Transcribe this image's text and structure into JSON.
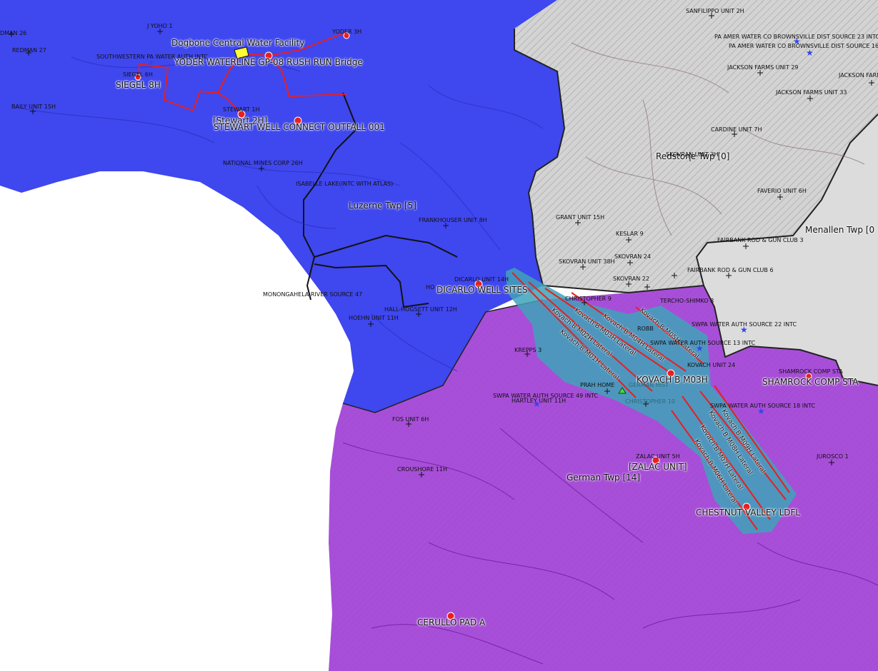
{
  "map": {
    "colors": {
      "luzerne": "#3f47ee",
      "german": "#a84fd9",
      "redstone": "#d3d3d3",
      "menallen": "#dcdcdc",
      "corridor": "#3fa2b8",
      "pipeline_red": "#e81f1f",
      "road": "#121212",
      "background": "#ffffff"
    },
    "townships": {
      "luzerne": "Luzerne Twp [5]",
      "german": "German Twp [14]",
      "redstone": "Redstone Twp [0]",
      "menallen": "Menallen Twp [0"
    },
    "sites": {
      "dogbone": "Dogbone Central Water Facility",
      "yoder_waterline": "YODER WATERLINE GP-08 RUSH RUN Bridge",
      "siegel": "SIEGEL 8H",
      "stewart": "[Stewart 2H]",
      "stewart_outfall": "STEWART WELL CONNECT OUTFALL 001",
      "dicarlo": "DICARLO WELL SITES",
      "kovach": "KOVACH B M03H",
      "shamrock": "SHAMROCK COMP STA",
      "zalac": "[ZALAC UNIT]",
      "chestnut": "CHESTNUT VALLEY LDFL",
      "cerullo": "CERULLO PAD A"
    },
    "laterals": [
      "Kovach B M01H Lateral",
      "Kovach B M02H Lateral",
      "Kovach B M03H Lateral",
      "Kovach B M04H Lateral",
      "Kovach B M05H Lateral",
      "Kovach B M06H Lateral",
      "Kovach B M07H Lateral",
      "Kovach B M08H Lateral",
      "Kovach B M09H Lateral"
    ],
    "well_labels": {
      "dman26": "DMAN 26",
      "redman27": "REDMAN 27",
      "jyoho1": "J YOHO 1",
      "yoder3h": "YODER 3H",
      "southwestern": "SOUTHWESTERN PA WATER AUTH INTC",
      "siegel6h": "SIEGEL 6H",
      "baily15h": "BAILY UNIT 15H",
      "stewart1h": "STEWART 1H",
      "nationalmines": "NATIONAL MINES CORP 26H",
      "isabelle": "ISABELLE LAKE(INTC WITH ATLAS)",
      "frankhouser": "FRANKHOUSER UNIT 8H",
      "dicarlo14h": "DICARLO UNIT 14H",
      "monongahela": "MONONGAHELA RIVER SOURCE 47",
      "ho": "HO",
      "hallhogsett": "HALL-HOGSETT UNIT 12H",
      "hoehn": "HOEHN UNIT 11H",
      "sanfilippo": "SANFILIPPO UNIT 2H",
      "brownsville23": "PA AMER WATER CO BROWNSVILLE DIST SOURCE 23 INTC",
      "brownsville16": "PA AMER WATER CO BROWNSVILLE DIST SOURCE 16",
      "jackson29": "JACKSON FARMS UNIT 29",
      "jacksonfarm": "JACKSON FARM",
      "jackson33": "JACKSON FARMS UNIT 33",
      "cardine": "CARDINE UNIT 7H",
      "skovran3h": "SKOVRAN UNIT 3H",
      "faverio": "FAVERIO UNIT 6H",
      "grant": "GRANT UNIT 15H",
      "keslar": "KESLAR 9",
      "fairbank3": "FAIRBANK ROD & GUN CLUB 3",
      "skovran38h": "SKOVRAN UNIT 38H",
      "skovran24": "SKOVRAN 24",
      "fairbank6": "FAIRBANK ROD & GUN CLUB 6",
      "skovran22": "SKOVRAN 22",
      "christopher9": "CHRISTOPHER 9",
      "tercho": "TERCHO-SHIMKO 8",
      "swpa22": "SWPA WATER AUTH SOURCE 22 INTC",
      "robb": "ROBB",
      "swpa13": "SWPA WATER AUTH SOURCE 13 INTC",
      "krepps": "KREPPS 3",
      "kovach24": "KOVACH UNIT 24",
      "shamrocksmall": "SHAMROCK COMP STA",
      "prah": "PRAH HOME",
      "germanhist": "GERMAN HIST",
      "swpa49": "SWPA WATER AUTH SOURCE 49 INTC",
      "hartley": "HARTLEY UNIT 11H",
      "christopher10": "CHRISTOPHER 10",
      "swpa18": "SWPA WATER AUTH SOURCE 18 INTC",
      "fos": "FOS UNIT 6H",
      "jurosco": "JUROSCO 1",
      "zalac5h": "ZALAC UNIT 5H",
      "croushore": "CROUSHORE 11H"
    }
  }
}
